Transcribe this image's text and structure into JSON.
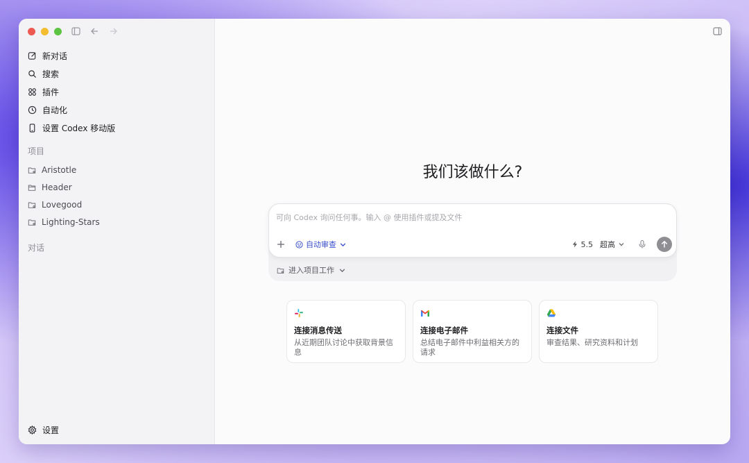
{
  "sidebar": {
    "nav": [
      {
        "label": "新对话",
        "icon": "edit-icon"
      },
      {
        "label": "搜索",
        "icon": "search-icon"
      },
      {
        "label": "插件",
        "icon": "grid-icon"
      },
      {
        "label": "自动化",
        "icon": "clock-icon"
      },
      {
        "label": "设置 Codex 移动版",
        "icon": "phone-icon"
      }
    ],
    "projects_label": "项目",
    "projects": [
      {
        "label": "Aristotle",
        "icon": "folder-git-icon"
      },
      {
        "label": "Header",
        "icon": "folder-icon"
      },
      {
        "label": "Lovegood",
        "icon": "folder-git-icon"
      },
      {
        "label": "Lighting-Stars",
        "icon": "folder-git-icon"
      }
    ],
    "chats_label": "对话",
    "settings_label": "设置"
  },
  "main": {
    "headline": "我们该做什么?",
    "composer": {
      "placeholder": "可向 Codex 询问任何事。输入 @ 使用插件或提及文件",
      "auto_review": "自动审查",
      "model_version": "5.5",
      "model_level": "超高"
    },
    "project_select": "进入项目工作",
    "cards": [
      {
        "title": "连接消息传送",
        "desc": "从近期团队讨论中获取背景信息",
        "icon": "slack-icon"
      },
      {
        "title": "连接电子邮件",
        "desc": "总结电子邮件中利益相关方的请求",
        "icon": "gmail-icon"
      },
      {
        "title": "连接文件",
        "desc": "审查结果、研究资料和计划",
        "icon": "drive-icon"
      }
    ]
  },
  "colors": {
    "accent": "#3b50c9",
    "send_button": "#8e8e93",
    "traffic_red": "#ee5a52",
    "traffic_yellow": "#f4bd2f",
    "traffic_green": "#5dc342"
  }
}
